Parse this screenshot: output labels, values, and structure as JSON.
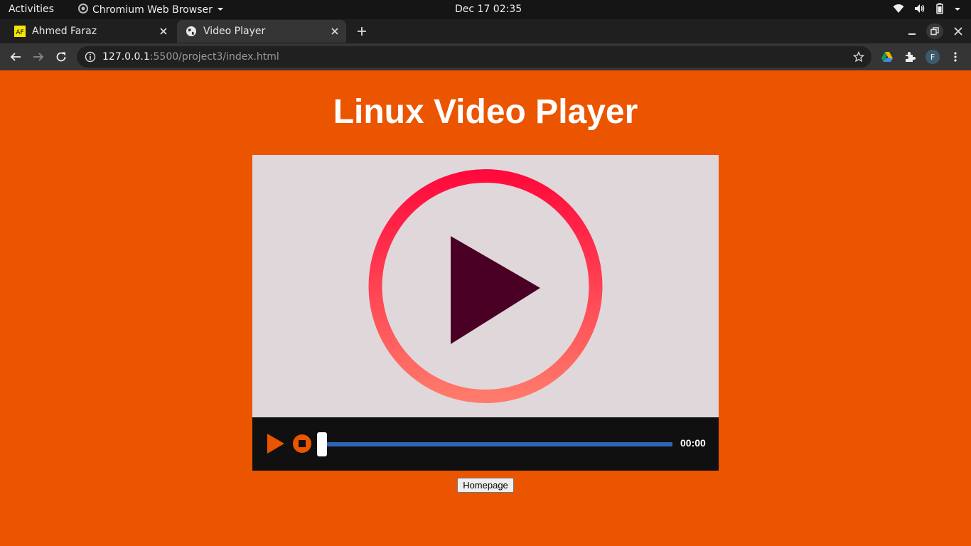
{
  "topbar": {
    "activities": "Activities",
    "app_name": "Chromium Web Browser",
    "clock": "Dec 17  02:35"
  },
  "tabs": [
    {
      "label": "Ahmed Faraz",
      "favicon_text": "AF",
      "active": false
    },
    {
      "label": "Video Player",
      "active": true
    }
  ],
  "toolbar": {
    "url_host": "127.0.0.1",
    "url_rest": ":5500/project3/index.html",
    "profile_initial": "F"
  },
  "page": {
    "title": "Linux Video Player",
    "time_display": "00:00",
    "progress_fraction": 0,
    "homepage_button": "Homepage"
  },
  "colors": {
    "page_background": "#eb5500",
    "video_background": "#e0d7da",
    "controls_background": "#101010",
    "progress_track": "#2f65b5",
    "play_icon": "#eb5500",
    "triangle_fill": "#4a0024"
  },
  "icons": [
    "chromium-icon",
    "wifi-icon",
    "volume-icon",
    "battery-icon",
    "power-menu-icon",
    "back-icon",
    "forward-icon",
    "reload-icon",
    "info-icon",
    "star-icon",
    "drive-icon",
    "extensions-icon",
    "menu-icon",
    "play-icon",
    "stop-icon"
  ]
}
